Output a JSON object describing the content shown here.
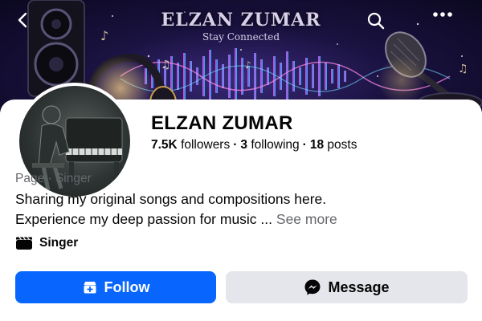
{
  "cover": {
    "title": "ELZAN ZUMAR",
    "subtitle": "Stay Connected"
  },
  "header": {
    "back_icon": "chevron-left-icon",
    "search_icon": "search-icon",
    "more_icon": "more-dots-icon"
  },
  "profile": {
    "name": "ELZAN ZUMAR",
    "followers_count": "7.5K",
    "followers_label": "followers",
    "following_count": "3",
    "following_label": "following",
    "posts_count": "18",
    "posts_label": "posts",
    "category_line": "Page · Singer",
    "bio_line1": "Sharing my original songs and compositions here.",
    "bio_line2": "Experience my deep passion for music ...",
    "see_more": "See more",
    "tag_label": "Singer",
    "tag_icon": "clapperboard-icon"
  },
  "actions": {
    "follow_label": "Follow",
    "follow_icon": "add-page-icon",
    "message_label": "Message",
    "message_icon": "messenger-icon"
  },
  "colors": {
    "accent": "#0866ff",
    "secondary_button": "#e4e6eb",
    "muted_text": "#65676b"
  }
}
